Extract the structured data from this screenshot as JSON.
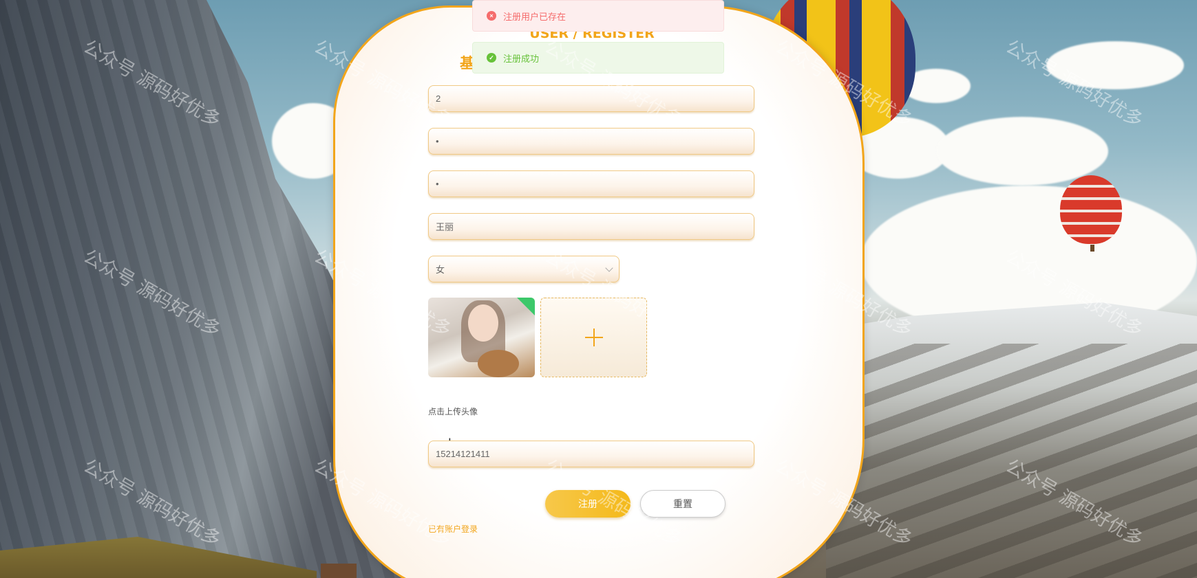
{
  "header": {
    "title": "USER / REGISTER",
    "subtitle_partial": "基"
  },
  "toasts": {
    "error": "注册用户已存在",
    "success": "注册成功"
  },
  "form": {
    "account_value": "2",
    "password_value": "•",
    "confirm_password_value": "•",
    "name_value": "王丽",
    "gender_value": "女",
    "upload_hint": "点击上传头像",
    "phone_value": "15214121411"
  },
  "actions": {
    "register_label": "注册",
    "reset_label": "重置",
    "login_link": "已有账户登录"
  },
  "watermark": "公众号 源码好优多",
  "colors": {
    "accent": "#f2a51a",
    "error": "#f56c6c",
    "success": "#67c23a"
  },
  "icons": {
    "error": "close-circle-icon",
    "success": "check-circle-icon",
    "upload": "plus-icon",
    "select": "chevron-down-icon"
  }
}
